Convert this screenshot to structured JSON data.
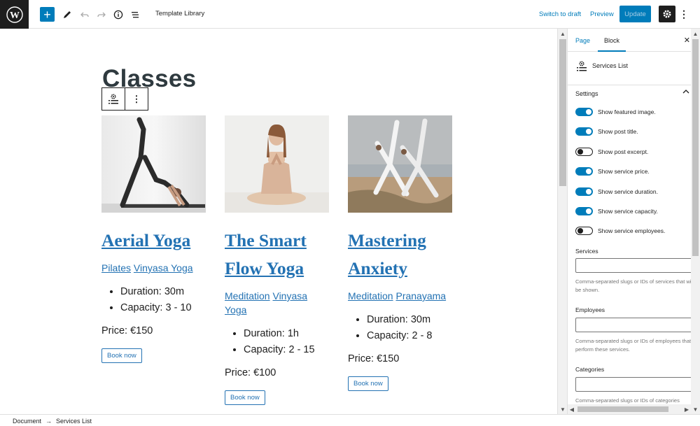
{
  "toolbar": {
    "title": "Template Library",
    "switch_to_draft": "Switch to draft",
    "preview": "Preview",
    "update": "Update",
    "add_icon": "plus-icon",
    "colors": {
      "accent": "#007cba",
      "dark": "#1e1e1e"
    }
  },
  "canvas": {
    "heading": "Classes",
    "services": [
      {
        "title_line1": "Aerial Yoga",
        "title_line2": "",
        "categories": [
          "Pilates",
          "Vinyasa Yoga"
        ],
        "details": [
          "Duration: 30m",
          "Capacity: 3 - 10"
        ],
        "price": "Price: €150",
        "button": "Book now"
      },
      {
        "title_line1": "The Smart",
        "title_line2": "Flow Yoga",
        "categories": [
          "Meditation",
          "Vinyasa Yoga"
        ],
        "details": [
          "Duration: 1h",
          "Capacity: 2 - 15"
        ],
        "price": "Price: €100",
        "button": "Book now"
      },
      {
        "title_line1": "Mastering",
        "title_line2": "Anxiety",
        "categories": [
          "Meditation",
          "Pranayama"
        ],
        "details": [
          "Duration: 30m",
          "Capacity: 2 - 8"
        ],
        "price": "Price: €150",
        "button": "Book now"
      }
    ]
  },
  "sidebar": {
    "tabs": [
      "Page",
      "Block"
    ],
    "active_tab": "Block",
    "block_name": "Services List",
    "section_title": "Settings",
    "toggles": [
      {
        "label": "Show featured image.",
        "on": true
      },
      {
        "label": "Show post title.",
        "on": true
      },
      {
        "label": "Show post excerpt.",
        "on": false
      },
      {
        "label": "Show service price.",
        "on": true
      },
      {
        "label": "Show service duration.",
        "on": true
      },
      {
        "label": "Show service capacity.",
        "on": true
      },
      {
        "label": "Show service employees.",
        "on": false
      }
    ],
    "fields": [
      {
        "label": "Services",
        "help": "Comma-separated slugs or IDs of services that will be shown."
      },
      {
        "label": "Employees",
        "help": "Comma-separated slugs or IDs of employees that perform these services."
      },
      {
        "label": "Categories",
        "help": "Comma-separated slugs or IDs of categories"
      }
    ]
  },
  "footer": {
    "breadcrumb": [
      "Document",
      "Services List"
    ],
    "separator": "→"
  }
}
